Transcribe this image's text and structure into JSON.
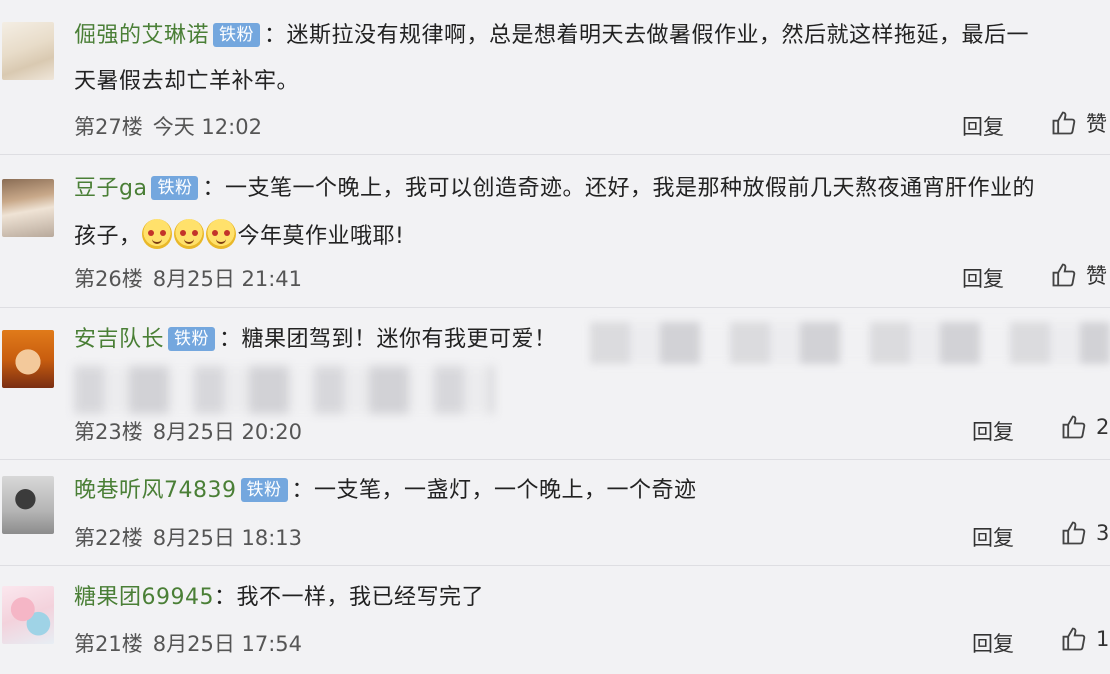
{
  "labels": {
    "reply": "回复",
    "fan_badge": "铁粉"
  },
  "comments": [
    {
      "username": "倔强的艾琳诺",
      "line1": "迷斯拉没有规律啊，总是想着明天去做暑假作业，然后就这样拖延，最后一",
      "line2": "天暑假去却亡羊补牢。",
      "floor": "第27楼",
      "time": "今天 12:02",
      "like": "赞"
    },
    {
      "username": "豆子ga",
      "line1": "一支笔一个晚上，我可以创造奇迹。还好，我是那种放假前几天熬夜通宵肝作业的",
      "line2_pre": "孩子，",
      "line2_post": "今年莫作业哦耶!",
      "floor": "第26楼",
      "time": "8月25日 21:41",
      "like": "赞"
    },
    {
      "username": "安吉队长",
      "line1": "糖果团驾到！迷你有我更可爱！",
      "floor": "第23楼",
      "time": "8月25日 20:20",
      "like": "2"
    },
    {
      "username": "晚巷听风74839",
      "line1": "一支笔，一盏灯，一个晚上，一个奇迹",
      "floor": "第22楼",
      "time": "8月25日 18:13",
      "like": "3"
    },
    {
      "username": "糖果团69945",
      "line1": "我不一样，我已经写完了",
      "floor": "第21楼",
      "time": "8月25日 17:54",
      "like": "1"
    }
  ]
}
